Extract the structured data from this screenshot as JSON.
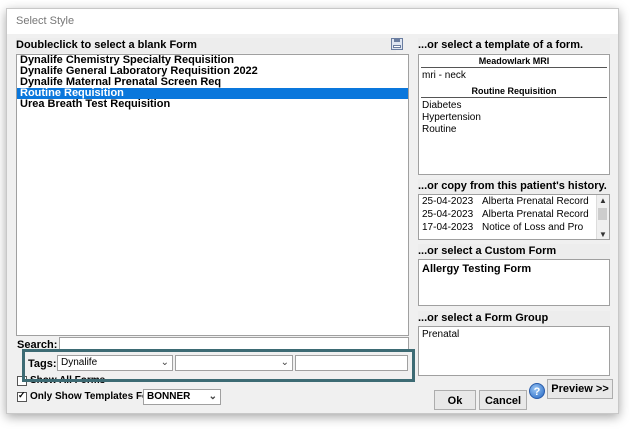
{
  "window": {
    "title": "Select Style"
  },
  "blank_forms": {
    "header": "Doubleclick to select a blank Form",
    "items": [
      "Dynalife Chemistry Specialty Requisition",
      "Dynalife General Laboratory Requisition 2022",
      "Dynalife Maternal Prenatal Screen Req",
      "Routine Requisition",
      "Urea Breath Test Requisition"
    ],
    "selected_index": 3
  },
  "templates": {
    "header": "...or select a template of a form.",
    "group1": {
      "title": "Meadowlark MRI",
      "items": [
        "mri - neck"
      ]
    },
    "group2": {
      "title": "Routine Requisition",
      "items": [
        "Diabetes",
        "Hypertension",
        "Routine"
      ]
    }
  },
  "history": {
    "header": "...or copy from this patient's history.",
    "rows": [
      {
        "date": "25-04-2023",
        "name": "Alberta Prenatal Record"
      },
      {
        "date": "25-04-2023",
        "name": "Alberta Prenatal Record"
      },
      {
        "date": "17-04-2023",
        "name": "Notice of Loss and Pro"
      }
    ]
  },
  "custom_form": {
    "header": "...or select a Custom Form",
    "items": [
      "Allergy Testing Form"
    ]
  },
  "form_group": {
    "header": "...or select a Form Group",
    "items": [
      "Prenatal"
    ]
  },
  "search": {
    "label": "Search:",
    "value": ""
  },
  "tags": {
    "label": "Tags:",
    "tag1": "Dynalife",
    "tag2": "",
    "tag3": ""
  },
  "options": {
    "show_all_forms": {
      "label": "Show All Forms",
      "checked": false
    },
    "only_show_templates": {
      "label": "Only Show Templates For:",
      "checked": true,
      "value": "BONNER"
    }
  },
  "buttons": {
    "preview": "Preview >>",
    "ok": "Ok",
    "cancel": "Cancel"
  },
  "colors": {
    "selection": "#0a77dc",
    "highlight_outline": "#3d6b74"
  }
}
